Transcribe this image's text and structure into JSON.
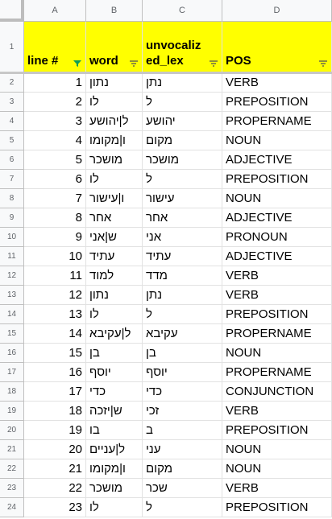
{
  "columns": [
    "A",
    "B",
    "C",
    "D"
  ],
  "row_numbers": [
    "1",
    "2",
    "3",
    "4",
    "5",
    "6",
    "7",
    "8",
    "9",
    "10",
    "11",
    "12",
    "13",
    "14",
    "15",
    "16",
    "17",
    "18",
    "19",
    "20",
    "21",
    "22",
    "23",
    "24"
  ],
  "header": {
    "line": "line #",
    "word": "word",
    "lex": "unvocaliz ed_lex",
    "pos": "POS"
  },
  "rows": [
    {
      "n": "1",
      "word": "נתון",
      "lex": "נתן",
      "pos": "VERB"
    },
    {
      "n": "2",
      "word": "לו",
      "lex": "ל",
      "pos": "PREPOSITION"
    },
    {
      "n": "3",
      "word": "ל|יהושע",
      "lex": "יהושע",
      "pos": "PROPERNAME"
    },
    {
      "n": "4",
      "word": "ו|מקומו",
      "lex": "מקום",
      "pos": "NOUN"
    },
    {
      "n": "5",
      "word": "מושכר",
      "lex": "מושכר",
      "pos": "ADJECTIVE"
    },
    {
      "n": "6",
      "word": "לו",
      "lex": "ל",
      "pos": "PREPOSITION"
    },
    {
      "n": "7",
      "word": "ו|עישור",
      "lex": "עישור",
      "pos": "NOUN"
    },
    {
      "n": "8",
      "word": "אחר",
      "lex": "אחר",
      "pos": "ADJECTIVE"
    },
    {
      "n": "9",
      "word": "ש|אני",
      "lex": "אני",
      "pos": "PRONOUN"
    },
    {
      "n": "10",
      "word": "עתיד",
      "lex": "עתיד",
      "pos": "ADJECTIVE"
    },
    {
      "n": "11",
      "word": "למוד",
      "lex": "מדד",
      "pos": "VERB"
    },
    {
      "n": "12",
      "word": "נתון",
      "lex": "נתן",
      "pos": "VERB"
    },
    {
      "n": "13",
      "word": "לו",
      "lex": "ל",
      "pos": "PREPOSITION"
    },
    {
      "n": "14",
      "word": "ל|עקיבא",
      "lex": "עקיבא",
      "pos": "PROPERNAME"
    },
    {
      "n": "15",
      "word": "בן",
      "lex": "בן",
      "pos": "NOUN"
    },
    {
      "n": "16",
      "word": "יוסף",
      "lex": "יוסף",
      "pos": "PROPERNAME"
    },
    {
      "n": "17",
      "word": "כדי",
      "lex": "כדי",
      "pos": "CONJUNCTION"
    },
    {
      "n": "18",
      "word": "ש|יזכה",
      "lex": "זכי",
      "pos": "VERB"
    },
    {
      "n": "19",
      "word": "בו",
      "lex": "ב",
      "pos": "PREPOSITION"
    },
    {
      "n": "20",
      "word": "ל|עניים",
      "lex": "עני",
      "pos": "NOUN"
    },
    {
      "n": "21",
      "word": "ו|מקומו",
      "lex": "מקום",
      "pos": "NOUN"
    },
    {
      "n": "22",
      "word": "מושכר",
      "lex": "שכר",
      "pos": "VERB"
    },
    {
      "n": "23",
      "word": "לו",
      "lex": "ל",
      "pos": "PREPOSITION"
    }
  ],
  "colors": {
    "header_fill": "#ffff00",
    "filter_active": "#0f9d58",
    "grid": "#e2e2e2",
    "header_bg": "#f8f9fa"
  },
  "icons": {
    "filter_active": "filter-funnel-icon",
    "filter": "filter-lines-icon"
  }
}
